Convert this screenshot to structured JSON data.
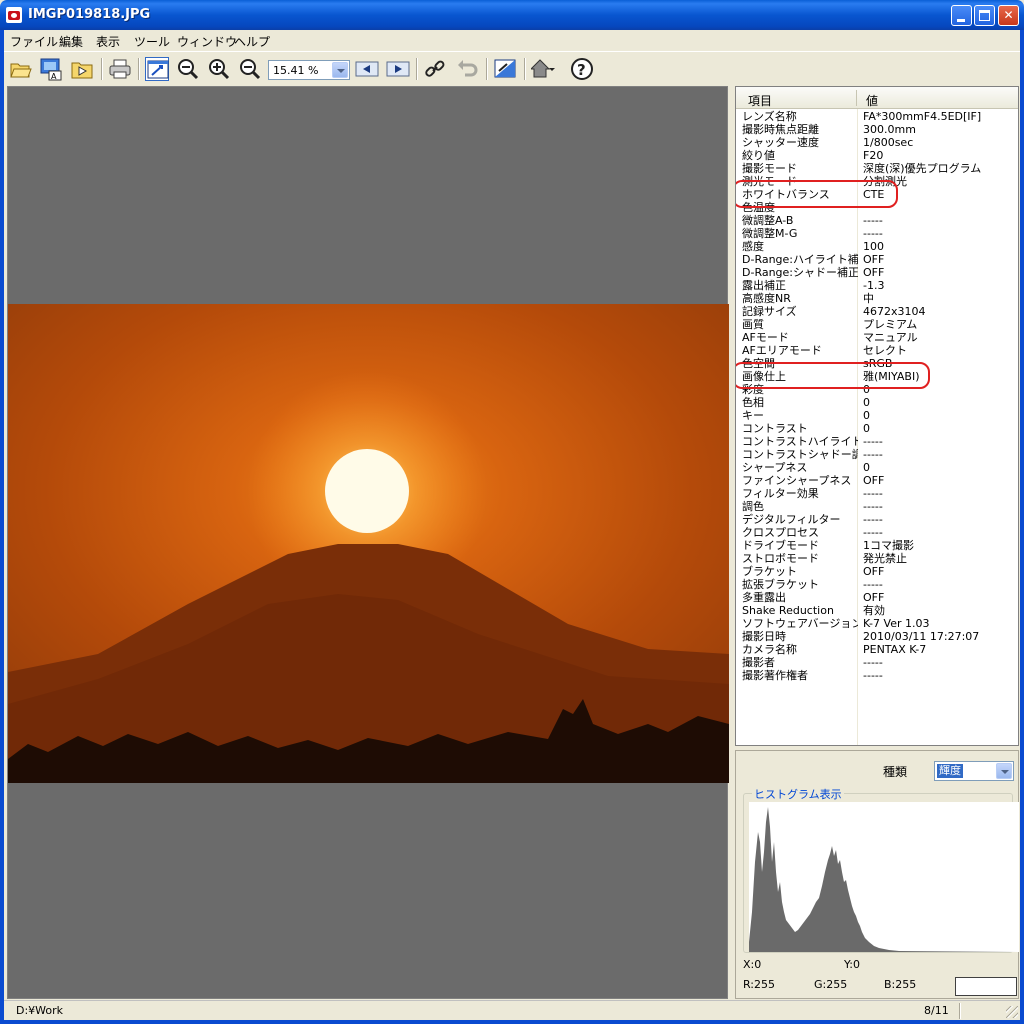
{
  "window": {
    "title": "IMGP019818.JPG"
  },
  "menu": [
    "ファイル",
    "編集",
    "表示",
    "ツール",
    "ウィンドウ",
    "ヘルプ"
  ],
  "toolbar": {
    "zoom": "15.41 %"
  },
  "properties": {
    "header_key": "項目",
    "header_value": "値",
    "rows": [
      [
        "レンズ名称",
        "FA*300mmF4.5ED[IF]"
      ],
      [
        "撮影時焦点距離",
        "300.0mm"
      ],
      [
        "シャッター速度",
        "1/800sec"
      ],
      [
        "絞り値",
        "F20"
      ],
      [
        "撮影モード",
        "深度(深)優先プログラム"
      ],
      [
        "測光モード",
        "分割測光"
      ],
      [
        "ホワイトバランス",
        "CTE"
      ],
      [
        "色温度",
        ""
      ],
      [
        "微調整A-B",
        "-----"
      ],
      [
        "微調整M-G",
        "-----"
      ],
      [
        "感度",
        "100"
      ],
      [
        "D-Range:ハイライト補...",
        "OFF"
      ],
      [
        "D-Range:シャドー補正",
        "OFF"
      ],
      [
        "露出補正",
        "-1.3"
      ],
      [
        "高感度NR",
        "中"
      ],
      [
        "記録サイズ",
        "4672x3104"
      ],
      [
        "画質",
        "プレミアム"
      ],
      [
        "AFモード",
        "マニュアル"
      ],
      [
        "AFエリアモード",
        "セレクト"
      ],
      [
        "色空間",
        "sRGB"
      ],
      [
        "画像仕上",
        "雅(MIYABI)"
      ],
      [
        "彩度",
        "0"
      ],
      [
        "色相",
        "0"
      ],
      [
        "キー",
        "0"
      ],
      [
        "コントラスト",
        "0"
      ],
      [
        "コントラストハイライト調...",
        "-----"
      ],
      [
        "コントラストシャドー調整",
        "-----"
      ],
      [
        "シャープネス",
        "0"
      ],
      [
        "ファインシャープネス",
        "OFF"
      ],
      [
        "フィルター効果",
        "-----"
      ],
      [
        "調色",
        "-----"
      ],
      [
        "デジタルフィルター",
        "-----"
      ],
      [
        "クロスプロセス",
        "-----"
      ],
      [
        "ドライブモード",
        "1コマ撮影"
      ],
      [
        "ストロボモード",
        "発光禁止"
      ],
      [
        "ブラケット",
        "OFF"
      ],
      [
        "拡張ブラケット",
        "-----"
      ],
      [
        "多重露出",
        "OFF"
      ],
      [
        "Shake Reduction",
        "有効"
      ],
      [
        "ソフトウェアバージョン",
        "K-7 Ver 1.03"
      ],
      [
        "撮影日時",
        "2010/03/11 17:27:07"
      ],
      [
        "カメラ名称",
        "PENTAX K-7"
      ],
      [
        "撮影者",
        "-----"
      ],
      [
        "撮影著作権者",
        "-----"
      ]
    ]
  },
  "histogram": {
    "kind_label": "種類",
    "kind_value": "輝度",
    "title": "ヒストグラム表示",
    "x": "X:0",
    "y": "Y:0",
    "r": "R:255",
    "g": "G:255",
    "b": "B:255"
  },
  "status": {
    "path": "D:¥Work",
    "page": "8/11"
  },
  "colors": {
    "highlight": "#e02020",
    "sky": "#b84a08",
    "sun": "#fffbe8"
  }
}
